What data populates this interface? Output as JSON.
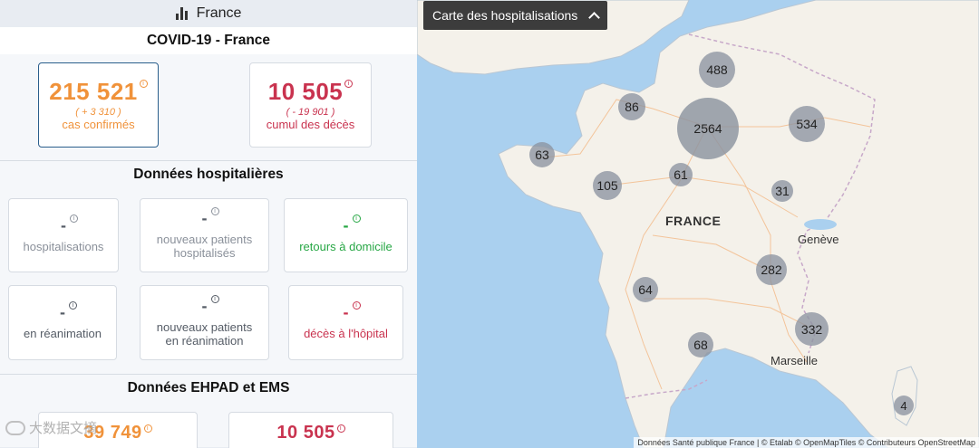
{
  "header": {
    "region": "France",
    "icon": "bar-chart-icon"
  },
  "covid": {
    "title": "COVID-19 - France",
    "confirmed": {
      "value": "215 521",
      "delta": "( + 3 310 )",
      "label": "cas confirmés"
    },
    "deaths": {
      "value": "10 505",
      "delta": "( - 19 901 )",
      "label": "cumul des décès"
    }
  },
  "hospital": {
    "title": "Données hospitalières",
    "cards": [
      {
        "value": "-",
        "label": "hospitalisations"
      },
      {
        "value": "-",
        "label": "nouveaux patients hospitalisés"
      },
      {
        "value": "-",
        "label": "retours à domicile"
      },
      {
        "value": "-",
        "label": "en réanimation"
      },
      {
        "value": "-",
        "label": "nouveaux patients en réanimation"
      },
      {
        "value": "-",
        "label": "décès à l'hôpital"
      }
    ]
  },
  "ehpad": {
    "title": "Données EHPAD et EMS",
    "card1_value": "39 749",
    "card2_value": "10 505"
  },
  "map": {
    "title": "Carte des hospitalisations",
    "country_label": "FRANCE",
    "cities": [
      "Genève",
      "Marseille"
    ],
    "clusters": [
      "488",
      "86",
      "2564",
      "534",
      "63",
      "61",
      "105",
      "31",
      "282",
      "64",
      "332",
      "68",
      "4"
    ],
    "attribution": "Données Santé publique France | © Etalab © OpenMapTiles © Contributeurs OpenStreetMap"
  },
  "watermark": "大数据文摘",
  "colors": {
    "orange": "#f0923a",
    "crimson": "#c9334f",
    "green": "#27a745",
    "grey": "#8a909a",
    "sea": "#aad0ef",
    "land": "#f4f1ea"
  }
}
